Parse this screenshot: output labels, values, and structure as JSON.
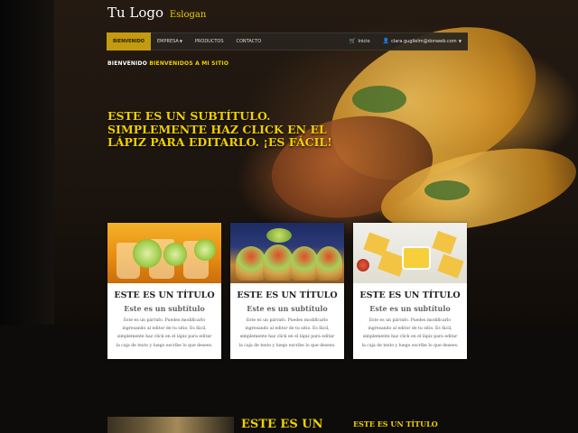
{
  "header": {
    "logo_text": "Tu Logo",
    "slogan": "Eslogan"
  },
  "nav": {
    "items": [
      {
        "label": "Bienvenido",
        "active": true
      },
      {
        "label": "Empresa",
        "dropdown": true
      },
      {
        "label": "Productos"
      },
      {
        "label": "Contacto"
      }
    ],
    "cart_label": "Inicio",
    "account_label": "clara.guglielm@donweb.com"
  },
  "welcome": {
    "prefix": "Bienvenido",
    "highlight": "Bienvenidos a mi sitio"
  },
  "hero": {
    "subtitle": "Este es un subtítulo. Simplemente haz click en el lápiz para editarlo. ¡Es fácil!"
  },
  "cards": [
    {
      "title": "Este es un título",
      "subtitle": "Este es un subtítulo",
      "body": "Este es un párrafo. Puedes modificarlo ingresando al editor de tu sitio. Es fácil, simplemente haz click en el lápiz para editar la caja de texto y luego escribe lo que desees."
    },
    {
      "title": "Este es un título",
      "subtitle": "Este es un subtítulo",
      "body": "Este es un párrafo. Puedes modificarlo ingresando al editor de tu sitio. Es fácil, simplemente haz click en el lápiz para editar la caja de texto y luego escribe lo que desees."
    },
    {
      "title": "Este es un título",
      "subtitle": "Este es un subtítulo",
      "body": "Este es un párrafo. Puedes modificarlo ingresando al editor de tu sitio. Es fácil, simplemente haz click en el lápiz para editar la caja de texto y luego escribe lo que desees."
    }
  ],
  "bottom": {
    "heading": "Este es un",
    "right_title": "Este es un título"
  },
  "colors": {
    "accent": "#f0d000",
    "nav_active": "#c49a10",
    "card_bg": "#ffffff"
  },
  "icons": {
    "cart": "cart-icon",
    "user": "user-icon",
    "caret": "caret-down-icon"
  }
}
